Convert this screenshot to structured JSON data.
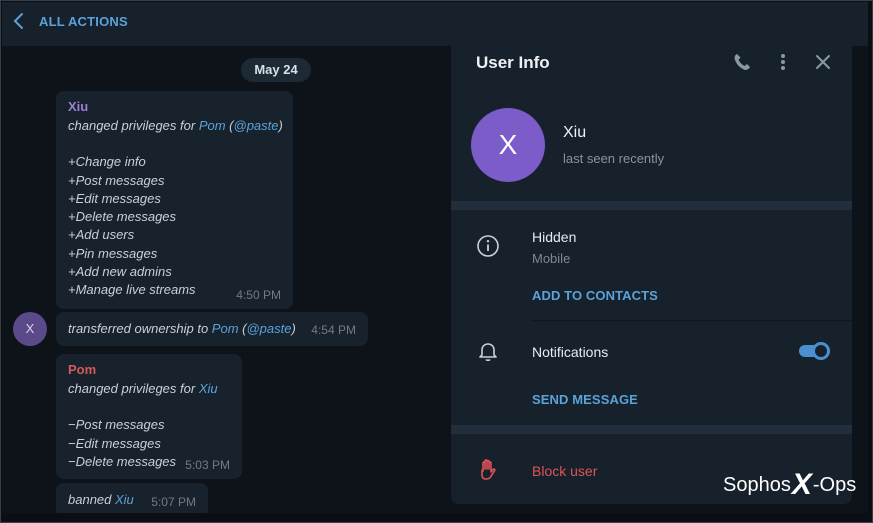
{
  "topbar": {
    "title": "ALL ACTIONS"
  },
  "chat": {
    "date": "May 24",
    "messages": {
      "m1": {
        "author": "Xiu",
        "line1_prefix": "changed privileges for ",
        "line1_name": "Pom",
        "line1_open": " (",
        "line1_handle": "@paste",
        "line1_close": ")",
        "perms": [
          "+Change info",
          "+Post messages",
          "+Edit messages",
          "+Delete messages",
          "+Add users",
          "+Pin messages",
          "+Add new admins",
          "+Manage live streams"
        ],
        "time": "4:50 PM"
      },
      "m2": {
        "avatar": "X",
        "prefix": "transferred ownership to ",
        "name": "Pom",
        "open": " (",
        "handle": "@paste",
        "close": ")",
        "time": "4:54 PM"
      },
      "m3": {
        "author": "Pom",
        "line1_prefix": "changed privileges for ",
        "line1_name": "Xiu",
        "perms": [
          "−Post messages",
          "−Edit messages",
          "−Delete messages"
        ],
        "time": "5:03 PM"
      },
      "m4": {
        "prefix": "banned ",
        "name": "Xiu",
        "time": "5:07 PM"
      }
    }
  },
  "panel": {
    "title": "User Info",
    "avatar_letter": "X",
    "name": "Xiu",
    "status": "last seen recently",
    "phone": {
      "value": "Hidden",
      "label": "Mobile"
    },
    "add_contacts": "ADD TO CONTACTS",
    "notifications": {
      "label": "Notifications",
      "enabled": true
    },
    "send_message": "SEND MESSAGE",
    "block": "Block user"
  },
  "watermark": {
    "left": "Sophos",
    "mid": "X",
    "right": "-Ops"
  },
  "colors": {
    "accent": "#5aa2da",
    "author_xiu": "#9b7fd4",
    "author_pom": "#d15a5a",
    "danger": "#e0525a"
  }
}
